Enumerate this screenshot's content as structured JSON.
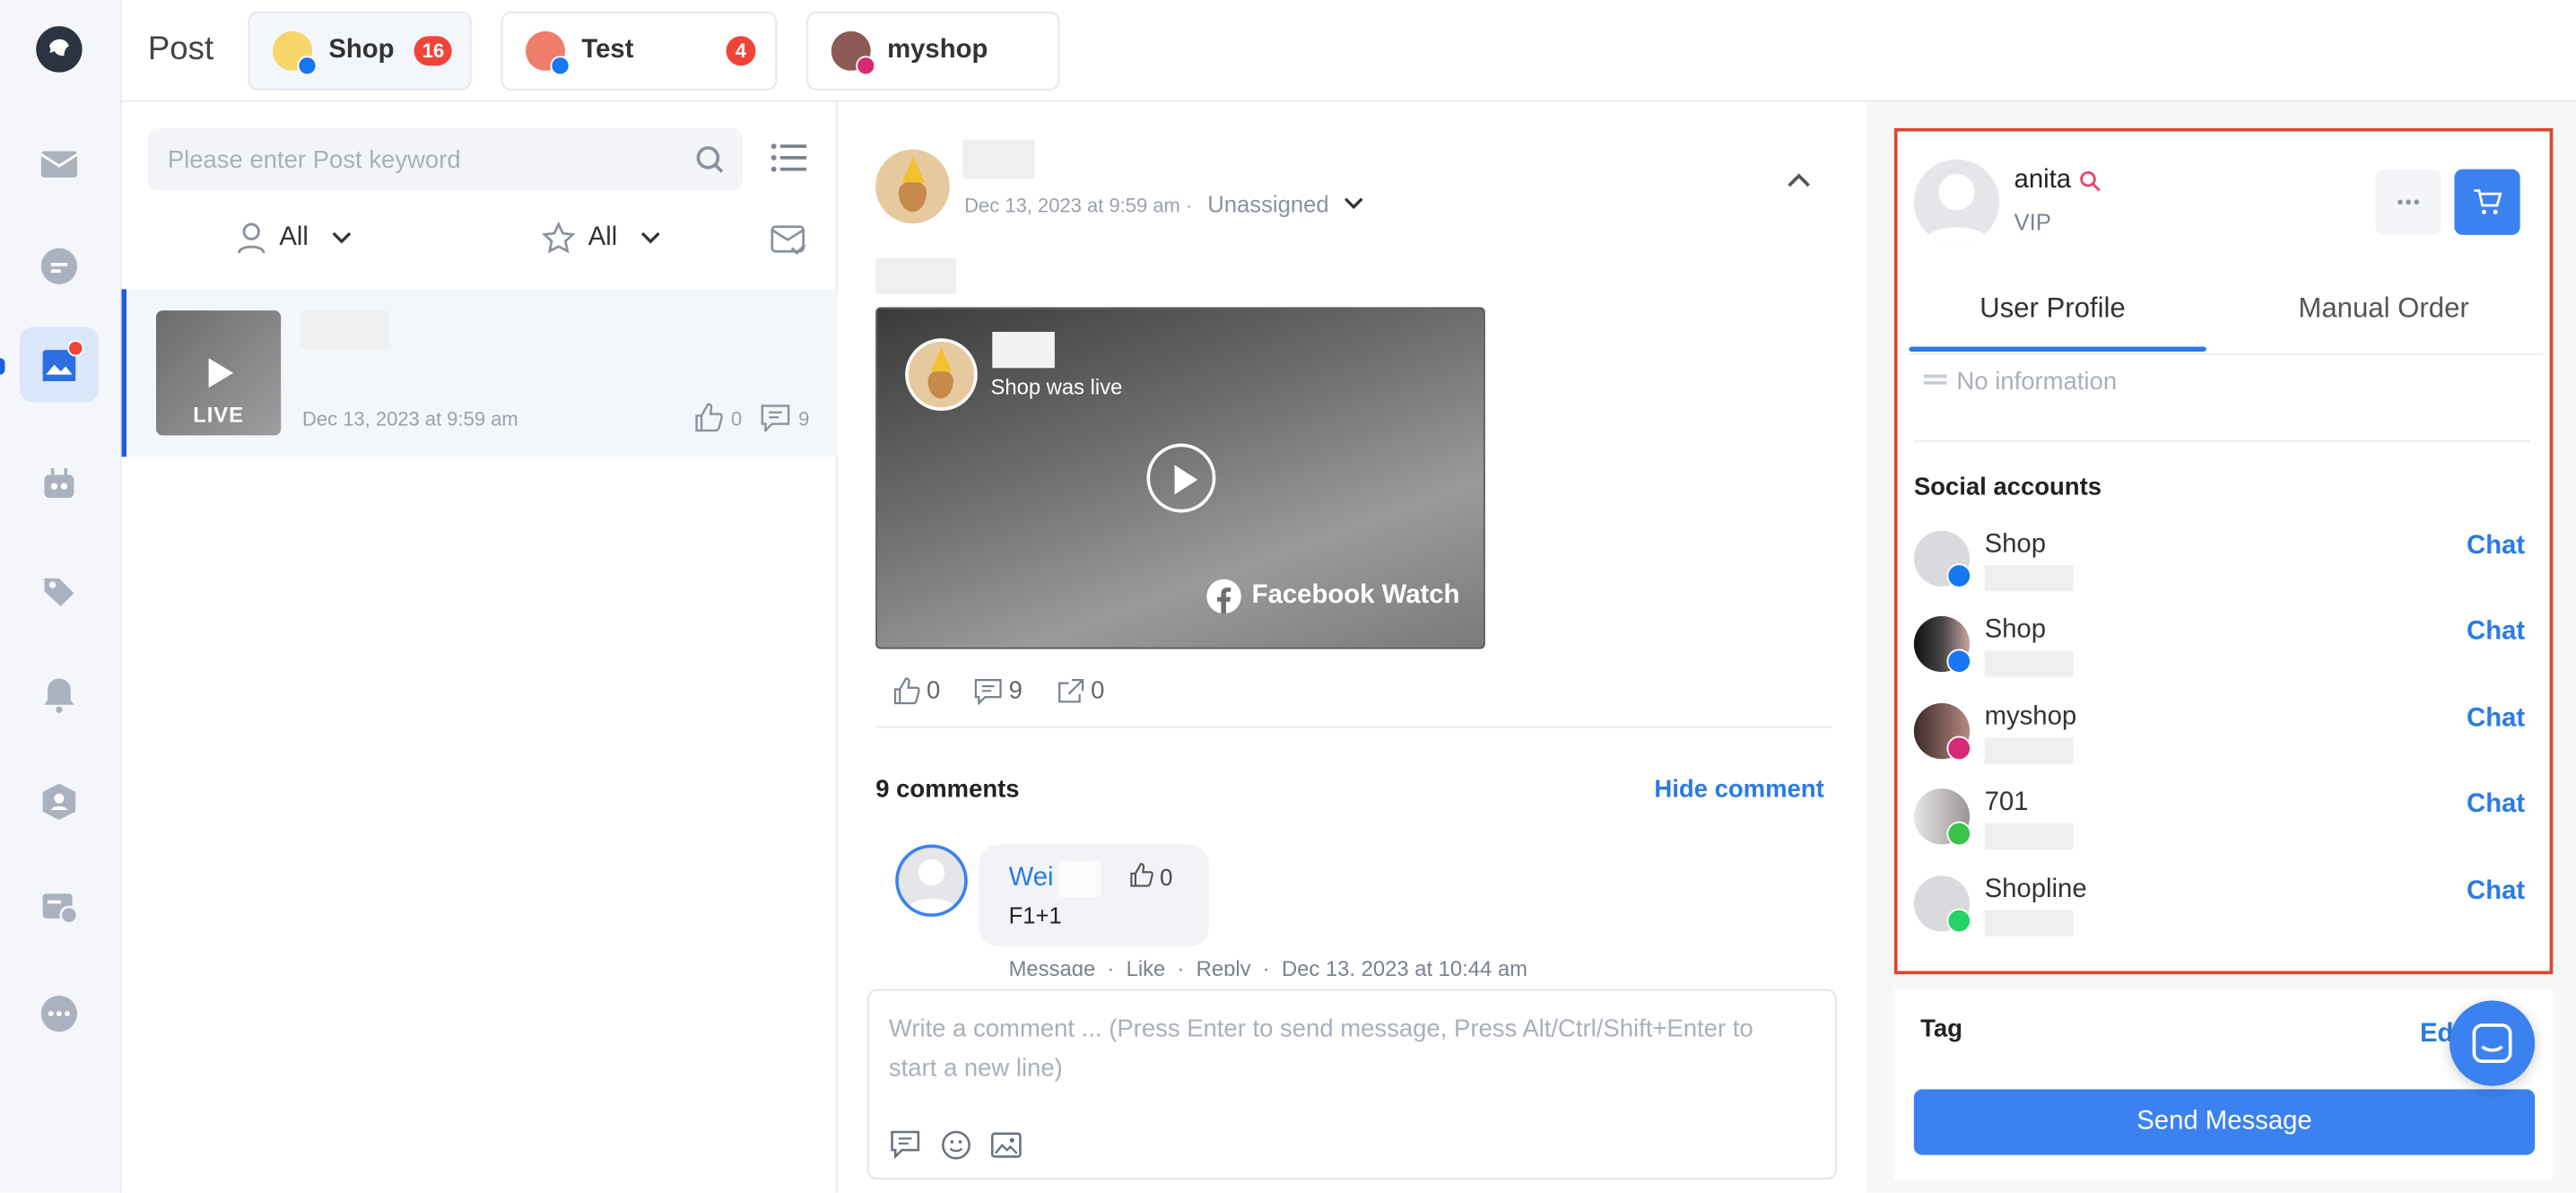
{
  "topbar": {
    "title": "Post",
    "tabs": [
      {
        "name": "Shop",
        "badge": "16",
        "platform": "facebook"
      },
      {
        "name": "Test",
        "badge": "4",
        "platform": "facebook"
      },
      {
        "name": "myshop",
        "badge": "",
        "platform": "instagram"
      }
    ]
  },
  "rail": {
    "items": [
      "mail-icon",
      "chat-bubble-icon",
      "post-image-icon",
      "bot-icon",
      "tag-icon",
      "bell-icon",
      "contact-icon",
      "ticket-icon",
      "more-icon"
    ]
  },
  "list": {
    "search_placeholder": "Please enter Post keyword",
    "filter_assignee": "All",
    "filter_star": "All",
    "post": {
      "live_label": "LIVE",
      "date": "Dec 13, 2023 at 9:59 am",
      "likes": "0",
      "comments": "9"
    }
  },
  "detail": {
    "date": "Dec 13, 2023 at 9:59 am ·",
    "assignee": "Unassigned",
    "video": {
      "caption": "Shop was live",
      "brand": "Facebook Watch"
    },
    "stats": {
      "likes": "0",
      "comments": "9",
      "shares": "0"
    },
    "comments_count": "9 comments",
    "hide_comment": "Hide comment",
    "comment": {
      "author": "Wei",
      "text": "F1+1",
      "likes": "0",
      "actions": "Message  ·  Like  ·  Reply  ·  Dec 13, 2023 at 10:44 am"
    },
    "compose_placeholder": "Write a comment ... (Press Enter to send message, Press Alt/Ctrl/Shift+Enter to start a new line)"
  },
  "profile": {
    "name": "anita",
    "level": "VIP",
    "tabs": {
      "profile": "User Profile",
      "manual_order": "Manual Order"
    },
    "no_info": "No information",
    "social_title": "Social accounts",
    "chat_label": "Chat",
    "accounts": [
      {
        "name": "Shop",
        "platform": "facebook"
      },
      {
        "name": "Shop",
        "platform": "facebook"
      },
      {
        "name": "myshop",
        "platform": "instagram"
      },
      {
        "name": "701",
        "platform": "line"
      },
      {
        "name": "Shopline",
        "platform": "whatsapp"
      }
    ],
    "tag_label": "Tag",
    "edit_label": "Ed",
    "send_message": "Send Message"
  },
  "colors": {
    "accent": "#2b7be4",
    "badge": "#f04438",
    "highlight_border": "#e0432e"
  }
}
